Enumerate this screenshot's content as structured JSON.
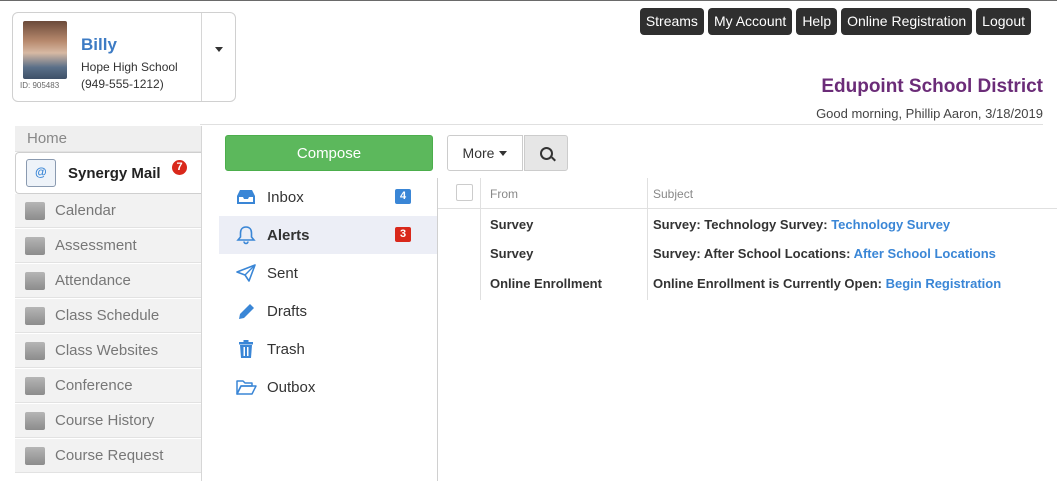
{
  "student": {
    "name": "Billy",
    "school": "Hope High School",
    "phone": "(949-555-1212)",
    "id_label": "ID: 905483"
  },
  "top_nav": [
    "Streams",
    "My Account",
    "Help",
    "Online Registration",
    "Logout"
  ],
  "district": "Edupoint School District",
  "greeting": "Good morning, Phillip Aaron, 3/18/2019",
  "left_nav": {
    "home": "Home",
    "active": {
      "label": "Synergy Mail",
      "badge": "7"
    },
    "items": [
      "Calendar",
      "Assessment",
      "Attendance",
      "Class Schedule",
      "Class Websites",
      "Conference",
      "Course History",
      "Course Request"
    ]
  },
  "toolbar": {
    "compose": "Compose",
    "more": "More"
  },
  "folders": [
    {
      "label": "Inbox",
      "count": "4",
      "badge_color": "#3a86d6",
      "icon": "inbox-icon"
    },
    {
      "label": "Alerts",
      "count": "3",
      "badge_color": "#d9281b",
      "icon": "bell-icon",
      "active": true
    },
    {
      "label": "Sent",
      "count": "",
      "icon": "paper-plane-icon"
    },
    {
      "label": "Drafts",
      "count": "",
      "icon": "pencil-icon"
    },
    {
      "label": "Trash",
      "count": "",
      "icon": "trash-icon"
    },
    {
      "label": "Outbox",
      "count": "",
      "icon": "folder-open-icon"
    }
  ],
  "mail_list": {
    "headers": {
      "from": "From",
      "subject": "Subject"
    },
    "rows": [
      {
        "from": "Survey",
        "subject": "Survey: Technology Survey: ",
        "link": "Technology Survey"
      },
      {
        "from": "Survey",
        "subject": "Survey: After School Locations: ",
        "link": "After School Locations"
      },
      {
        "from": "Online Enrollment",
        "subject": "Online Enrollment is Currently Open: ",
        "link": "Begin Registration"
      }
    ]
  },
  "colors": {
    "accent_blue": "#3a86d6",
    "district_purple": "#6b2c78",
    "compose_green": "#5cb85c",
    "alert_red": "#d9281b"
  }
}
